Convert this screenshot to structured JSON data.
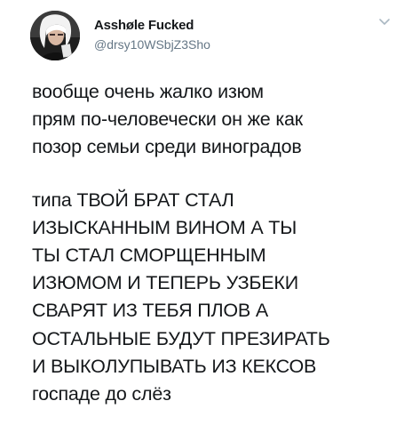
{
  "tweet": {
    "author": {
      "display_name": "Asshøle Fucked",
      "handle": "@drsy10WSbjZ3Sho",
      "avatar_icon": "user-avatar"
    },
    "menu_icon": "chevron-down-icon",
    "lines_paragraph_1": [
      "вообще очень жалко изюм",
      "прям по-человечески он же как",
      "позор семьи среди виноградов"
    ],
    "lines_paragraph_2": [
      "типа ТВОЙ БРАТ СТАЛ",
      "ИЗЫСКАННЫМ ВИНОМ А ТЫ",
      "ТЫ СТАЛ СМОРЩЕННЫМ",
      "ИЗЮМОМ И ТЕПЕРЬ УЗБЕКИ",
      "СВАРЯТ ИЗ ТЕБЯ ПЛОВ А",
      "ОСТАЛЬНЫЕ БУДУТ ПРЕЗИРАТЬ",
      "И ВЫКОЛУПЫВАТЬ ИЗ КЕКСОВ",
      "госпаде до слёз"
    ]
  },
  "colors": {
    "text": "#14171a",
    "secondary_text": "#657786",
    "background": "#ffffff"
  }
}
